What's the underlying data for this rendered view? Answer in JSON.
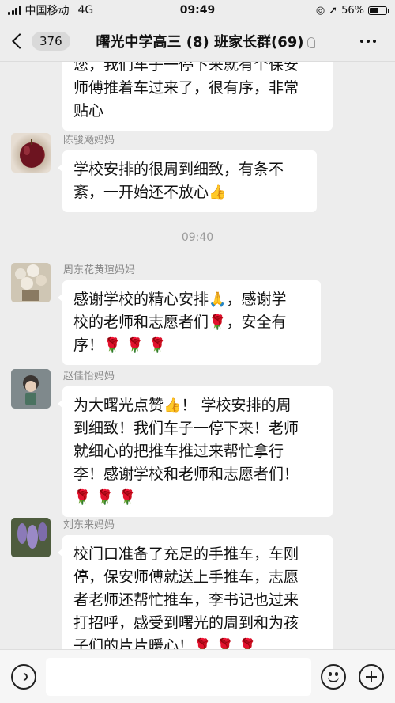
{
  "status_bar": {
    "carrier": "中国移动",
    "network": "4G",
    "time": "09:49",
    "battery": "56%",
    "battery_level": 0.56
  },
  "nav": {
    "unread_count": "376",
    "title": "曙光中学高三 (8) 班家长群(69)"
  },
  "messages": [
    {
      "sender": "",
      "text_lines": [
        "您，我们车子一停下来就有个保安",
        "师傅推着车过来了，很有序，非常",
        "贴心"
      ]
    },
    {
      "sender": "陈骏飏妈妈",
      "text_lines": [
        "学校安排的很周到细致，有条不",
        "紊，一开始还不放心"
      ],
      "emoji": "👍"
    },
    {
      "time": "09:40"
    },
    {
      "sender": "周东花黄瑄妈妈",
      "text_lines": [
        "感谢学校的精心安排",
        "校的老师和志愿者们",
        "序！"
      ],
      "line1_tail": "，感谢学",
      "line2_tail": "，安全有"
    },
    {
      "sender": "赵佳怡妈妈",
      "text_lines": [
        "为大曙光点赞",
        "到细致！我们车子一停下来！老师",
        "就细心的把推车推过来帮忙拿行",
        "李！感谢学校和老师和志愿者们！"
      ],
      "line1_tail": "！ 学校安排的周"
    },
    {
      "sender": "刘东来妈妈",
      "text_lines": [
        "校门口准备了充足的手推车，车刚",
        "停，保安师傅就送上手推车，志愿",
        "者老师还帮忙推车，李书记也过来",
        "打招呼，感受到曙光的周到和为孩",
        "子们的片片暖心！"
      ]
    }
  ],
  "emojis": {
    "thumbs_up": "👍",
    "clap": "🙏",
    "rose": "🌹"
  },
  "input": {
    "placeholder": ""
  }
}
